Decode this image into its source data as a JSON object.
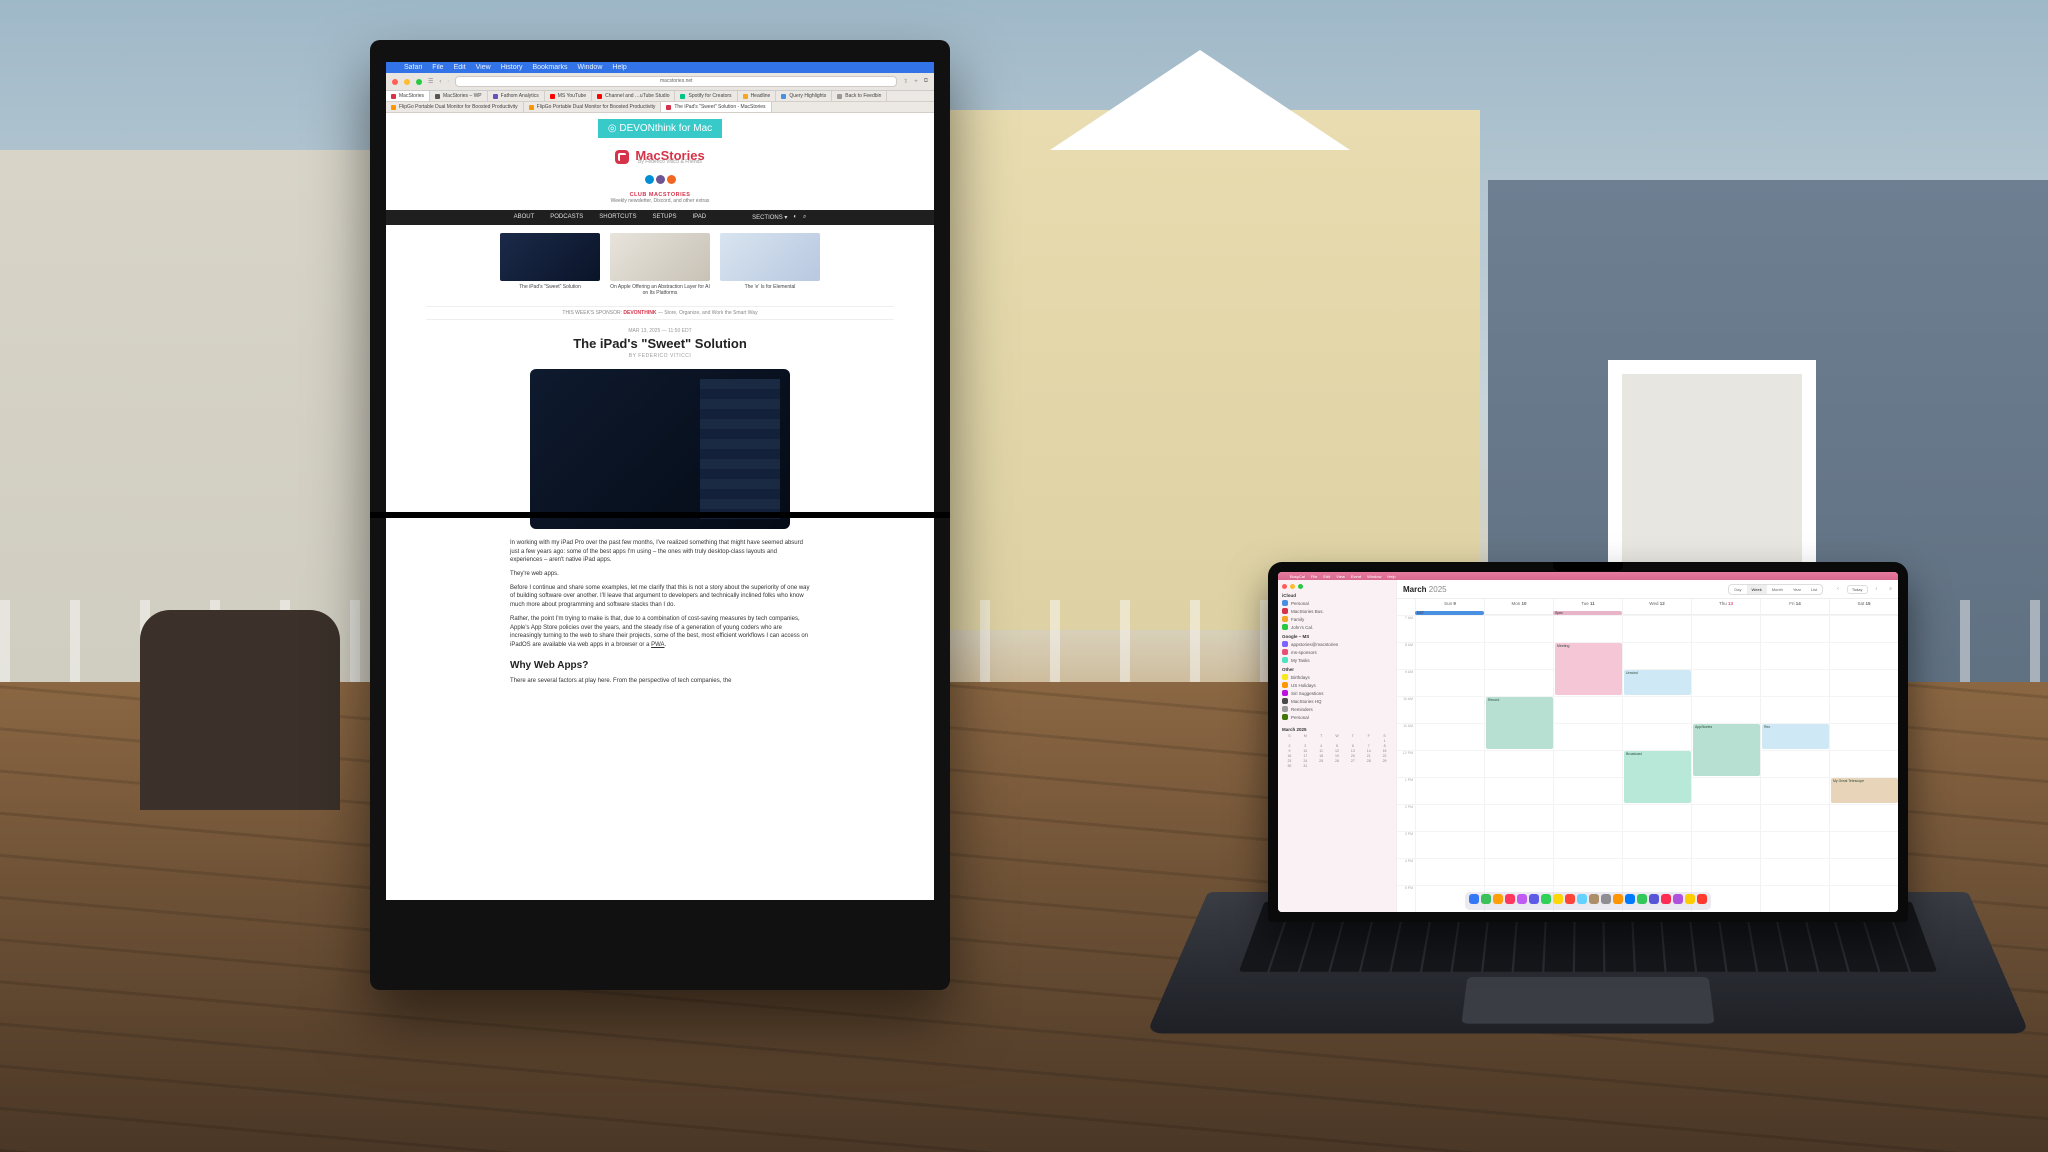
{
  "external_monitor": {
    "menubar": {
      "app": "Safari",
      "items": [
        "File",
        "Edit",
        "View",
        "History",
        "Bookmarks",
        "Window",
        "Help"
      ]
    },
    "url": "macstories.net",
    "tabs_row1": [
      {
        "favicon": "#d6334a",
        "label": "MacStories"
      },
      {
        "favicon": "#555",
        "label": "MacStories – WP"
      },
      {
        "favicon": "#6a4fbf",
        "label": "Fathom Analytics"
      },
      {
        "favicon": "#ff0000",
        "label": "MS YouTube"
      },
      {
        "favicon": "#ff0000",
        "label": "Channel and …uTube Studio"
      },
      {
        "favicon": "#00c389",
        "label": "Spotify for Creators"
      },
      {
        "favicon": "#f5a623",
        "label": "Headline"
      },
      {
        "favicon": "#4a90e2",
        "label": "Query Highlights"
      },
      {
        "favicon": "#999",
        "label": "Back to Feedbin"
      }
    ],
    "tabs_row2": [
      {
        "favicon": "#ff9500",
        "label": "FlipGo Portable Dual Monitor for Boosted Productivity"
      },
      {
        "favicon": "#ff9500",
        "label": "FlipGo Portable Dual Monitor for Boosted Productivity"
      },
      {
        "favicon": "#d6334a",
        "label": "The iPad's \"Sweet\" Solution - MacStories"
      }
    ],
    "ad": "DEVONthink for Mac",
    "site": {
      "name": "MacStories",
      "tagline": "By Federico Viticci & Friends"
    },
    "social_colors": [
      "#008fd5",
      "#6e5494",
      "#f26522"
    ],
    "club": {
      "title": "CLUB MACSTORIES",
      "sub": "Weekly newsletter, Discord, and other extras"
    },
    "nav": [
      "ABOUT",
      "PODCASTS",
      "SHORTCUTS",
      "SETUPS",
      "IPAD"
    ],
    "nav_right": "SECTIONS ▾",
    "featured": [
      {
        "caption": "The iPad's \"Sweet\" Solution"
      },
      {
        "caption": "On Apple Offering an Abstraction Layer for AI on Its Platforms"
      },
      {
        "caption": "The 'e' Is for Elemental"
      }
    ],
    "sponsor": {
      "label": "THIS WEEK'S SPONSOR:",
      "name": "DEVONTHINK",
      "tag": " — Store, Organize, and Work the Smart Way"
    },
    "article": {
      "date": "MAR 13, 2025 — 11:50 EDT",
      "title": "The iPad's \"Sweet\" Solution",
      "byline": "BY FEDERICO VITICCI",
      "p1": "In working with my iPad Pro over the past few months, I've realized something that might have seemed absurd just a few years ago: some of the best apps I'm using – the ones with truly desktop-class layouts and experiences – aren't native iPad apps.",
      "p2": "They're web apps.",
      "p3": "Before I continue and share some examples, let me clarify that this is not a story about the superiority of one way of building software over another. I'll leave that argument to developers and technically inclined folks who know much more about programming and software stacks than I do.",
      "p4": "Rather, the point I'm trying to make is that, due to a combination of cost-saving measures by tech companies, Apple's App Store policies over the years, and the steady rise of a generation of young coders who are increasingly turning to the web to share their projects, some of the best, most efficient workflows I can access on iPadOS are available via web apps in a browser or a ",
      "p4_link": "PWA",
      "h2": "Why Web Apps?",
      "p5": "There are several factors at play here. From the perspective of tech companies, the"
    }
  },
  "macbook": {
    "menubar": {
      "app": "BusyCal",
      "items": [
        "File",
        "Edit",
        "View",
        "Event",
        "Window",
        "Help"
      ]
    },
    "title_month": "March",
    "title_year": "2025",
    "view_seg": [
      "Day",
      "Week",
      "Month",
      "Year",
      "List"
    ],
    "view_active": "Week",
    "today_btn": "Today",
    "sidebar": {
      "accounts": [
        {
          "name": "iCloud",
          "cals": [
            {
              "color": "#4a90e2",
              "label": "Personal"
            },
            {
              "color": "#d6334a",
              "label": "MacStories Bus."
            },
            {
              "color": "#f5a623",
              "label": "Family"
            },
            {
              "color": "#28c840",
              "label": "John's Cal."
            }
          ]
        },
        {
          "name": "Google – MS",
          "cals": [
            {
              "color": "#7b61ff",
              "label": "appstories@macstories"
            },
            {
              "color": "#e94e77",
              "label": "ms-sponsors"
            },
            {
              "color": "#50e3c2",
              "label": "My Tasks"
            }
          ]
        },
        {
          "name": "Other",
          "cals": [
            {
              "color": "#f8e71c",
              "label": "Birthdays"
            },
            {
              "color": "#ff9500",
              "label": "US Holidays"
            },
            {
              "color": "#bd10e0",
              "label": "Siri Suggestions"
            },
            {
              "color": "#4a4a4a",
              "label": "MacStories HQ"
            },
            {
              "color": "#9b9b9b",
              "label": "Reminders"
            },
            {
              "color": "#417505",
              "label": "Personal"
            }
          ]
        }
      ],
      "mini_month": "March 2025",
      "mini_days": [
        "S",
        "M",
        "T",
        "W",
        "T",
        "F",
        "S",
        "",
        "",
        "",
        "",
        "",
        "",
        "1",
        "2",
        "3",
        "4",
        "5",
        "6",
        "7",
        "8",
        "9",
        "10",
        "11",
        "12",
        "13",
        "14",
        "15",
        "16",
        "17",
        "18",
        "19",
        "20",
        "21",
        "22",
        "23",
        "24",
        "25",
        "26",
        "27",
        "28",
        "29",
        "30",
        "31",
        "",
        "",
        "",
        "",
        "",
        ""
      ]
    },
    "day_headers": [
      {
        "dow": "Sun",
        "num": "9"
      },
      {
        "dow": "Mon",
        "num": "10"
      },
      {
        "dow": "Tue",
        "num": "11"
      },
      {
        "dow": "Wed",
        "num": "12"
      },
      {
        "dow": "Thu",
        "num": "13",
        "today": true
      },
      {
        "dow": "Fri",
        "num": "14"
      },
      {
        "dow": "Sat",
        "num": "15"
      }
    ],
    "allday": [
      {
        "col": 2,
        "color": "#4a90e2",
        "label": "DST"
      },
      {
        "col": 4,
        "color": "#e8b4c8",
        "label": "Spec"
      }
    ],
    "hours": [
      "7 AM",
      "8 AM",
      "9 AM",
      "10 AM",
      "11 AM",
      "12 PM",
      "1 PM",
      "2 PM",
      "3 PM",
      "4 PM",
      "5 PM"
    ],
    "events": [
      {
        "col": 3,
        "row": 5,
        "span": 2,
        "color": "#b8e0d2",
        "label": "Record"
      },
      {
        "col": 4,
        "row": 3,
        "span": 2,
        "color": "#f5c6d6",
        "label": "Meeting"
      },
      {
        "col": 5,
        "row": 4,
        "span": 1,
        "color": "#cfe8f5",
        "label": "Unwind"
      },
      {
        "col": 5,
        "row": 7,
        "span": 2,
        "color": "#b8e8d8",
        "label": "Broadcast"
      },
      {
        "col": 6,
        "row": 6,
        "span": 2,
        "color": "#b8e0d2",
        "label": "AppStories"
      },
      {
        "col": 7,
        "row": 6,
        "span": 1,
        "color": "#cfe8f5",
        "label": "Rec"
      },
      {
        "col": 8,
        "row": 8,
        "span": 1,
        "color": "#e8d4b8",
        "label": "My Great Telescope"
      }
    ],
    "dock_colors": [
      "#3478f6",
      "#3ac159",
      "#ff9f0a",
      "#ff375f",
      "#bf5af2",
      "#5e5ce6",
      "#30d158",
      "#ffd60a",
      "#ff453a",
      "#64d2ff",
      "#ac8e68",
      "#8e8e93",
      "#ff9500",
      "#007aff",
      "#34c759",
      "#5856d6",
      "#ff2d55",
      "#af52de",
      "#ffcc00",
      "#ff3b30"
    ]
  }
}
